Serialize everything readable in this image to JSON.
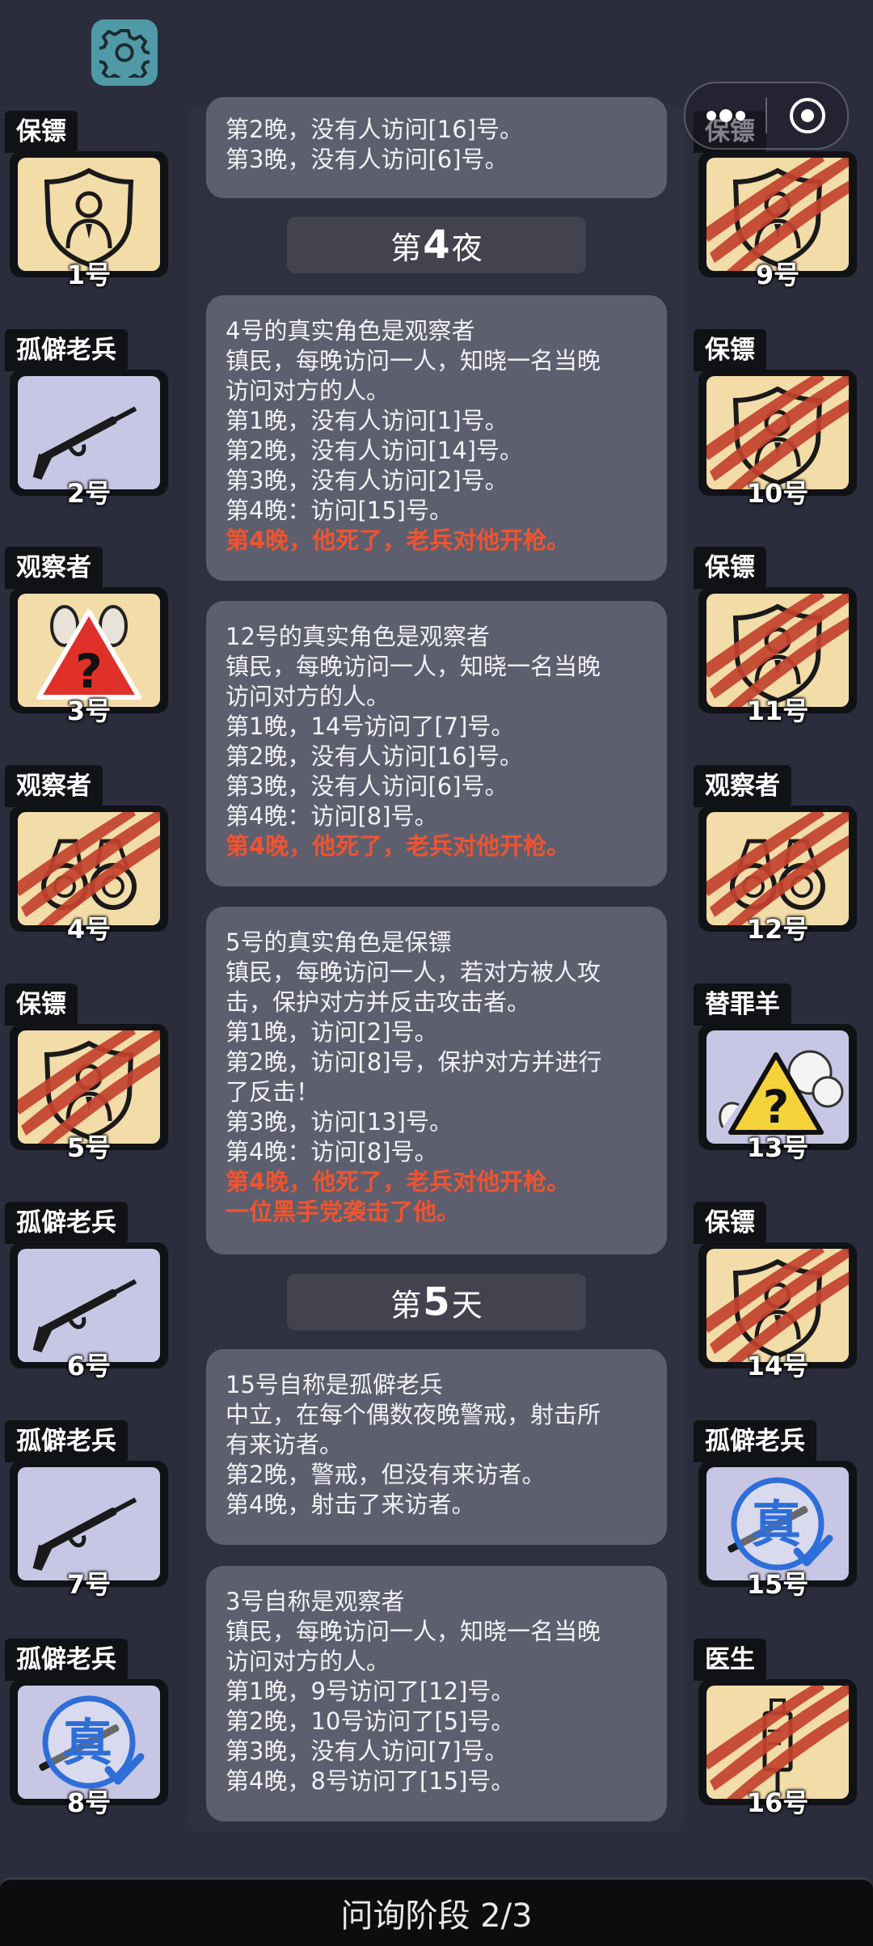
{
  "colors": {
    "background": "#2b2c3c",
    "card": "#5e5f6e",
    "accent_red": "#f0532f",
    "tile_yellow": "#f2dca8",
    "tile_lavender": "#c7c7e5",
    "settings_bg": "#4f9aa6"
  },
  "cards": [
    {
      "lines": [
        {
          "text": "第2晚，没有人访问[16]号。"
        },
        {
          "text": "第3晚，没有人访问[6]号。"
        }
      ]
    },
    {
      "lines": [
        {
          "text": "4号的真实角色是观察者"
        },
        {
          "text": "镇民，每晚访问一人，知晓一名当晚"
        },
        {
          "text": "访问对方的人。"
        },
        {
          "text": "第1晚，没有人访问[1]号。"
        },
        {
          "text": "第2晚，没有人访问[14]号。"
        },
        {
          "text": "第3晚，没有人访问[2]号。"
        },
        {
          "text": "第4晚：访问[15]号。"
        },
        {
          "text": "第4晚，他死了，老兵对他开枪。",
          "red": true
        }
      ]
    },
    {
      "lines": [
        {
          "text": "12号的真实角色是观察者"
        },
        {
          "text": "镇民，每晚访问一人，知晓一名当晚"
        },
        {
          "text": "访问对方的人。"
        },
        {
          "text": "第1晚，14号访问了[7]号。"
        },
        {
          "text": "第2晚，没有人访问[16]号。"
        },
        {
          "text": "第3晚，没有人访问[6]号。"
        },
        {
          "text": "第4晚：访问[8]号。"
        },
        {
          "text": "第4晚，他死了，老兵对他开枪。",
          "red": true
        }
      ]
    },
    {
      "lines": [
        {
          "text": "5号的真实角色是保镖"
        },
        {
          "text": "镇民，每晚访问一人，若对方被人攻"
        },
        {
          "text": "击，保护对方并反击攻击者。"
        },
        {
          "text": "第1晚，访问[2]号。"
        },
        {
          "text": "第2晚，访问[8]号，保护对方并进行"
        },
        {
          "text": "了反击！"
        },
        {
          "text": "第3晚，访问[13]号。"
        },
        {
          "text": "第4晚：访问[8]号。"
        },
        {
          "text": "第4晚，他死了，老兵对他开枪。",
          "red": true
        },
        {
          "text": "一位黑手党袭击了他。",
          "red": true
        }
      ]
    },
    {
      "lines": [
        {
          "text": "15号自称是孤僻老兵"
        },
        {
          "text": "中立，在每个偶数夜晚警戒，射击所"
        },
        {
          "text": "有来访者。"
        },
        {
          "text": "第2晚，警戒，但没有来访者。"
        },
        {
          "text": "第4晚，射击了来访者。"
        }
      ]
    },
    {
      "lines": [
        {
          "text": "3号自称是观察者"
        },
        {
          "text": "镇民，每晚访问一人，知晓一名当晚"
        },
        {
          "text": "访问对方的人。"
        },
        {
          "text": "第1晚，9号访问了[12]号。"
        },
        {
          "text": "第2晚，10号访问了[5]号。"
        },
        {
          "text": "第3晚，没有人访问[7]号。"
        },
        {
          "text": "第4晚，8号访问了[15]号。"
        }
      ]
    }
  ],
  "headers": [
    {
      "prefix": "第",
      "num": "4",
      "suffix": "夜"
    },
    {
      "prefix": "第",
      "num": "5",
      "suffix": "天"
    }
  ],
  "players_left": [
    {
      "role": "保镖",
      "number": "1号",
      "bg": "yellow",
      "icon": "bodyguard-shield-icon",
      "dead": false
    },
    {
      "role": "孤僻老兵",
      "number": "2号",
      "bg": "lavender",
      "icon": "rifle-icon",
      "dead": false
    },
    {
      "role": "观察者",
      "number": "3号",
      "bg": "yellow",
      "icon": "warning-question-icon",
      "dead": false
    },
    {
      "role": "观察者",
      "number": "4号",
      "bg": "yellow",
      "icon": "binoculars-icon",
      "dead": true
    },
    {
      "role": "保镖",
      "number": "5号",
      "bg": "yellow",
      "icon": "bodyguard-shield-icon",
      "dead": true
    },
    {
      "role": "孤僻老兵",
      "number": "6号",
      "bg": "lavender",
      "icon": "rifle-icon",
      "dead": false
    },
    {
      "role": "孤僻老兵",
      "number": "7号",
      "bg": "lavender",
      "icon": "rifle-icon",
      "dead": false
    },
    {
      "role": "孤僻老兵",
      "number": "8号",
      "bg": "lavender",
      "icon": "verified-true-icon",
      "dead": false,
      "stamp": "真"
    }
  ],
  "players_right": [
    {
      "role": "保镖",
      "number": "9号",
      "bg": "yellow",
      "icon": "bodyguard-shield-icon",
      "dead": true
    },
    {
      "role": "保镖",
      "number": "10号",
      "bg": "yellow",
      "icon": "bodyguard-shield-icon",
      "dead": true
    },
    {
      "role": "保镖",
      "number": "11号",
      "bg": "yellow",
      "icon": "bodyguard-shield-icon",
      "dead": true
    },
    {
      "role": "观察者",
      "number": "12号",
      "bg": "yellow",
      "icon": "binoculars-icon",
      "dead": true
    },
    {
      "role": "替罪羊",
      "number": "13号",
      "bg": "lavender",
      "icon": "sheep-question-icon",
      "dead": false
    },
    {
      "role": "保镖",
      "number": "14号",
      "bg": "yellow",
      "icon": "bodyguard-shield-icon",
      "dead": true
    },
    {
      "role": "孤僻老兵",
      "number": "15号",
      "bg": "lavender",
      "icon": "verified-true-icon",
      "dead": false,
      "stamp": "真"
    },
    {
      "role": "医生",
      "number": "16号",
      "bg": "yellow",
      "icon": "syringe-icon",
      "dead": true
    }
  ],
  "bottom_bar": {
    "phase_label": "问询阶段 2/3"
  }
}
